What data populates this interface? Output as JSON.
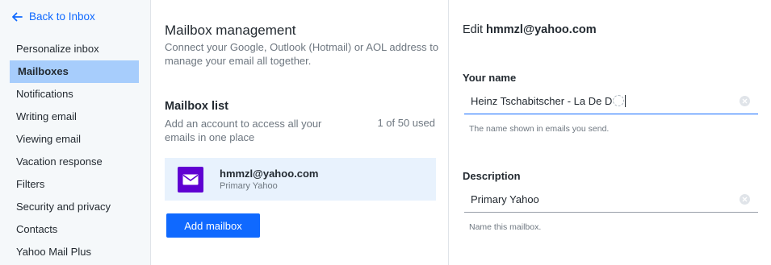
{
  "sidebar": {
    "back_label": "Back to Inbox",
    "items": [
      {
        "label": "Personalize inbox"
      },
      {
        "label": "Mailboxes",
        "active": true
      },
      {
        "label": "Notifications"
      },
      {
        "label": "Writing email"
      },
      {
        "label": "Viewing email"
      },
      {
        "label": "Vacation response"
      },
      {
        "label": "Filters"
      },
      {
        "label": "Security and privacy"
      },
      {
        "label": "Contacts"
      },
      {
        "label": "Yahoo Mail Plus"
      }
    ]
  },
  "mailbox_management": {
    "title": "Mailbox management",
    "description": "Connect your Google, Outlook (Hotmail) or AOL address to manage your email all together."
  },
  "mailbox_list": {
    "title": "Mailbox list",
    "description": "Add an account to access all your emails in one place",
    "count": "1 of 50 used",
    "mailboxes": [
      {
        "email": "hmmzl@yahoo.com",
        "type": "Primary Yahoo"
      }
    ],
    "add_button": "Add mailbox"
  },
  "edit": {
    "title_prefix": "Edit",
    "title_email": "hmmzl@yahoo.com",
    "name_label": "Your name",
    "name_value": "Heinz Tschabitscher - La De Du",
    "name_hint": "The name shown in emails you send.",
    "description_label": "Description",
    "description_value": "Primary Yahoo",
    "description_hint": "Name this mailbox."
  },
  "colors": {
    "accent": "#0f69ff",
    "active_nav": "#a7cdfc",
    "mailbox_icon": "#6001d2",
    "card_bg": "#e8f2fd"
  },
  "icons": [
    "arrow-left-icon",
    "mail-icon",
    "clear-icon",
    "emoji-icon"
  ]
}
